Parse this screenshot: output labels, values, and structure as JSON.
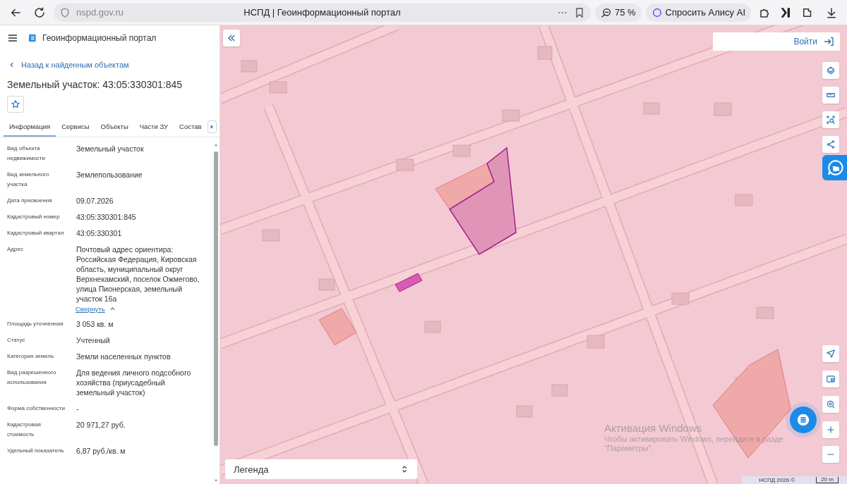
{
  "browser": {
    "url": "nspd.gov.ru",
    "title": "НСПД | Геоинформационный портал",
    "zoom": "75 %",
    "assistant": "Спросить Алису AI"
  },
  "app": {
    "title": "Геоинформационный портал"
  },
  "panel": {
    "back": "Назад к найденным объектам",
    "heading": "Земельный участок: 43:05:330301:845",
    "favorite": false,
    "tabs": [
      {
        "label": "Информация",
        "selected": true
      },
      {
        "label": "Сервисы",
        "selected": false
      },
      {
        "label": "Объекты",
        "selected": false
      },
      {
        "label": "Части ЗУ",
        "selected": false
      },
      {
        "label": "Состав",
        "selected": false
      }
    ],
    "fields": [
      {
        "label": "Вид объекта недвижимости",
        "value": "Земельный участок"
      },
      {
        "label": "Вид земельного участка",
        "value": "Землепользование"
      },
      {
        "label": "Дата присвоения",
        "value": "09.07.2026"
      },
      {
        "label": "Кадастровый номер",
        "value": "43:05:330301:845"
      },
      {
        "label": "Кадастровый квартал",
        "value": "43:05:330301"
      },
      {
        "label": "Адрес",
        "value": "Почтовый адрес ориентира: Российская Федерация, Кировская область, муниципальный округ Верхнекамский, поселок Ожмегово, улица Пионерская, земельный участок 16а",
        "toggle": "Свернуть",
        "expanded": true
      },
      {
        "label": "Площадь уточненная",
        "value": "3 053 кв. м"
      },
      {
        "label": "Статус",
        "value": "Учтенный"
      },
      {
        "label": "Категория земель",
        "value": "Земли населенных пунктов"
      },
      {
        "label": "Вид разрешенного использования",
        "value": "Для ведения личного подсобного хозяйства (приусадебный земельный участок)"
      },
      {
        "label": "Форма собственности",
        "value": "-"
      },
      {
        "label": "Кадастровая стоимость",
        "value": "20 971,27 руб."
      },
      {
        "label": "Удельный показатель",
        "value": "6,87 руб./кв. м"
      }
    ]
  },
  "map": {
    "login": "Войти",
    "legend": "Легенда",
    "copyright": "НСПД 2026 ©",
    "scale": "20 m",
    "notice": {
      "title": "Активация Windows",
      "lines": [
        "Чтобы активировать Windows, перейдите в разде",
        "\"Параметры\"."
      ]
    }
  }
}
